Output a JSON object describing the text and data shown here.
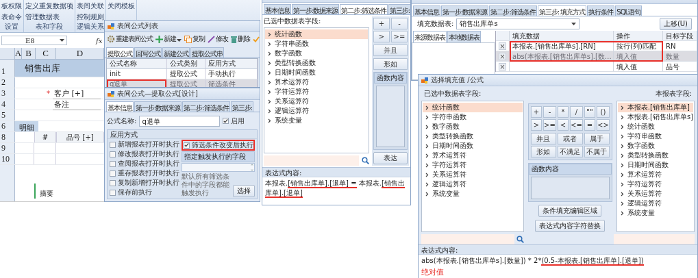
{
  "ribbon": {
    "groups": [
      {
        "label": "设置",
        "items": [
          "板权限",
          "表命令"
        ]
      },
      {
        "label": "表和字段",
        "items": [
          "定义重复数据项",
          "管理数据表"
        ]
      },
      {
        "label": "逻辑关系",
        "items": [
          "表间关联",
          "控制规则"
        ]
      },
      {
        "items": [
          "关闭模板"
        ]
      }
    ]
  },
  "formula_bar": {
    "cell": "E8",
    "fx": "fx"
  },
  "sheet": {
    "columns": [
      "A",
      "B",
      "C",
      "D"
    ],
    "rows": [
      {
        "number": "1",
        "kind": "title",
        "text": "销售出库"
      },
      {
        "number": "2",
        "kind": "blank"
      },
      {
        "number": "3",
        "kind": "field",
        "required": "*",
        "text": "客户 [+]"
      },
      {
        "number": "4",
        "kind": "field",
        "text": "备注"
      },
      {
        "number": "5",
        "kind": "blank"
      },
      {
        "number": "6",
        "kind": "tab",
        "text": "明细"
      },
      {
        "number": "8",
        "kind": "header",
        "cells": [
          "#",
          "品号 [+]"
        ]
      },
      {
        "number": "9",
        "kind": "table_row"
      },
      {
        "number": "10",
        "kind": "table_row"
      },
      {
        "kind": "summary",
        "text": "摘要"
      }
    ]
  },
  "list_window": {
    "title": "表间公式列表",
    "toolbar": [
      {
        "kind": "gear",
        "label": "重建表间公式"
      },
      {
        "kind": "plus",
        "label": "新建",
        "dropdown": true
      },
      {
        "kind": "copy",
        "label": "复制"
      },
      {
        "kind": "pencil",
        "label": "修改"
      },
      {
        "kind": "trash",
        "label": "删除"
      },
      {
        "kind": "check"
      }
    ],
    "tabs": [
      {
        "label": "提取公式",
        "selected": true
      },
      {
        "label": "回写公式",
        "selected": false
      },
      {
        "label": "新建公式",
        "selected": false
      },
      {
        "label": "提取公式串",
        "selected": false
      }
    ],
    "columns": [
      "公式名称",
      "公式类别",
      "应用方式"
    ],
    "rows": [
      {
        "cells": [
          "init",
          "提取公式",
          "手动执行"
        ],
        "selected": false,
        "highlighted": false
      },
      {
        "cells": [
          "q退单",
          "提取公式",
          "筛选条件"
        ],
        "selected": true,
        "highlighted": true
      }
    ]
  },
  "design_window": {
    "title": "表间公式—提取公式[设计]",
    "tabs": [
      {
        "label": "基本信息",
        "selected": true
      },
      {
        "label": "第一步:数据来源",
        "selected": false
      },
      {
        "label": "第二步:筛选条件",
        "selected": false
      },
      {
        "label": "第三步:",
        "selected": false
      }
    ],
    "name_label": "公式名称:",
    "name_value": "q退单",
    "enable": {
      "label": "启用",
      "checked": true
    },
    "group_title": "应用方式",
    "options": [
      {
        "label": "新增报表打开时执行",
        "checked": false
      },
      {
        "label": "修改报表打开时执行",
        "checked": false
      },
      {
        "label": "查阅报表打开时执行",
        "checked": false
      },
      {
        "label": "重存报表打开时执行",
        "checked": false
      },
      {
        "label": "复制新增打开时执行",
        "checked": false
      },
      {
        "label": "保存前执行",
        "checked": false
      }
    ],
    "trigger": {
      "label": "筛选条件改变后执行",
      "checked": true,
      "highlighted": true
    },
    "trigger_fields_title": "指定触发执行的字段",
    "hint": "默认所有筛选条件中的字段都能触发执行",
    "select_button": "选择"
  },
  "filter_window": {
    "tabs": [
      {
        "label": "基本信息",
        "selected": false
      },
      {
        "label": "第一步:数据来源",
        "selected": false
      },
      {
        "label": "第二步:筛选条件",
        "selected": true
      },
      {
        "label": "第三步:",
        "selected": false
      }
    ],
    "fields_label": "已选中数据表字段:",
    "items": [
      {
        "label": "统计函数",
        "selected": true
      },
      {
        "label": "字符串函数",
        "selected": false
      },
      {
        "label": "数字函数",
        "selected": false
      },
      {
        "label": "类型转换函数",
        "selected": false
      },
      {
        "label": "日期时间函数",
        "selected": false
      },
      {
        "label": "算术运算符",
        "selected": false
      },
      {
        "label": "字符运算符",
        "selected": false
      },
      {
        "label": "关系运算符",
        "selected": false
      },
      {
        "label": "逻辑运算符",
        "selected": false
      },
      {
        "label": "系统变量",
        "selected": false
      }
    ],
    "operators": [
      "+",
      "-",
      ">",
      ">="
    ],
    "logic": [
      "并且",
      "形如"
    ],
    "function_title": "函数内容",
    "expr_button": "表达",
    "expression_label": "表达式内容:",
    "expression": [
      {
        "text": "本报表.",
        "underlined": false
      },
      {
        "text": "[销售出库单].[退单] =",
        "underlined": true
      },
      {
        "text": " 本报表.",
        "underlined": false
      },
      {
        "text": "[销售出库单].[退单]",
        "underlined": true
      }
    ]
  },
  "fill_window": {
    "tabs": [
      {
        "label": "基本信息",
        "selected": false
      },
      {
        "label": "第一步:数据来源",
        "selected": false
      },
      {
        "label": "第二步:筛选条件",
        "selected": false
      },
      {
        "label": "第三步: 填充方式",
        "selected": true
      },
      {
        "label": "执行条件",
        "selected": false
      },
      {
        "label": "SQL语句",
        "selected": false
      }
    ],
    "table_label": "填充数据表:",
    "table_value": "销售出库单s",
    "move_up": "上移(U)",
    "source_tabs": [
      {
        "label": "来源数据表",
        "selected": true
      },
      {
        "label": "本地数据表",
        "selected": false
      }
    ],
    "columns": [
      "填充数据",
      "操作",
      "目标字段"
    ],
    "rows": [
      {
        "delete": "×",
        "data": "本报表.[销售出库单s].[RN]",
        "op": "按行(列)匹配",
        "target": "RN",
        "selected": false,
        "highlighted": true
      },
      {
        "delete": "×",
        "data": "abs(本报表.[销售出库单s].[数…",
        "op": "填入值",
        "target": "数量",
        "selected": true,
        "highlighted": true
      },
      {
        "delete": "×",
        "op": "填入值",
        "target": "品号",
        "selected": false,
        "highlighted": false
      }
    ]
  },
  "dialog": {
    "title": "选择填充值 /公式",
    "left_label": "已选中数据表字段:",
    "left_items": [
      {
        "label": "统计函数",
        "selected": true
      },
      {
        "label": "字符串函数",
        "selected": false
      },
      {
        "label": "数字函数",
        "selected": false
      },
      {
        "label": "类型转换函数",
        "selected": false
      },
      {
        "label": "日期时间函数",
        "selected": false
      },
      {
        "label": "算术运算符",
        "selected": false
      },
      {
        "label": "字符运算符",
        "selected": false
      },
      {
        "label": "关系运算符",
        "selected": false
      },
      {
        "label": "逻辑运算符",
        "selected": false
      },
      {
        "label": "系统变量",
        "selected": false
      }
    ],
    "operators": [
      "+",
      "-",
      "*",
      "/",
      "\"\"",
      "()",
      ">",
      ">=",
      "<",
      "<=",
      "=",
      "<>"
    ],
    "logic": [
      "并且",
      "或者",
      "属于",
      "形如",
      "不满足",
      "不属于"
    ],
    "function_title": "函数内容",
    "buttons": [
      "条件填充编辑区域",
      "表达式内容字符替换"
    ],
    "right_label": "本报表字段:",
    "right_items": [
      {
        "label": "本报表.[销售出库单]",
        "selected": true
      },
      {
        "label": "本报表.[销售出库单s]",
        "selected": false
      },
      {
        "label": "统计函数",
        "selected": false
      },
      {
        "label": "字符串函数",
        "selected": false
      },
      {
        "label": "数字函数",
        "selected": false
      },
      {
        "label": "类型转换函数",
        "selected": false
      },
      {
        "label": "日期时间函数",
        "selected": false
      },
      {
        "label": "算术运算符",
        "selected": false
      },
      {
        "label": "字符运算符",
        "selected": false
      },
      {
        "label": "关系运算符",
        "selected": false
      },
      {
        "label": "逻辑运算符",
        "selected": false
      },
      {
        "label": "系统变量",
        "selected": false
      }
    ],
    "expression_label": "表达式内容:",
    "expression": [
      {
        "text": "abs(本报表.[销售出库单s].[数量]) * 2*",
        "underlined": false
      },
      {
        "text": "(0.5-本报表.[销售出库单].[退单])",
        "underlined": true
      }
    ],
    "note": "绝对值"
  }
}
